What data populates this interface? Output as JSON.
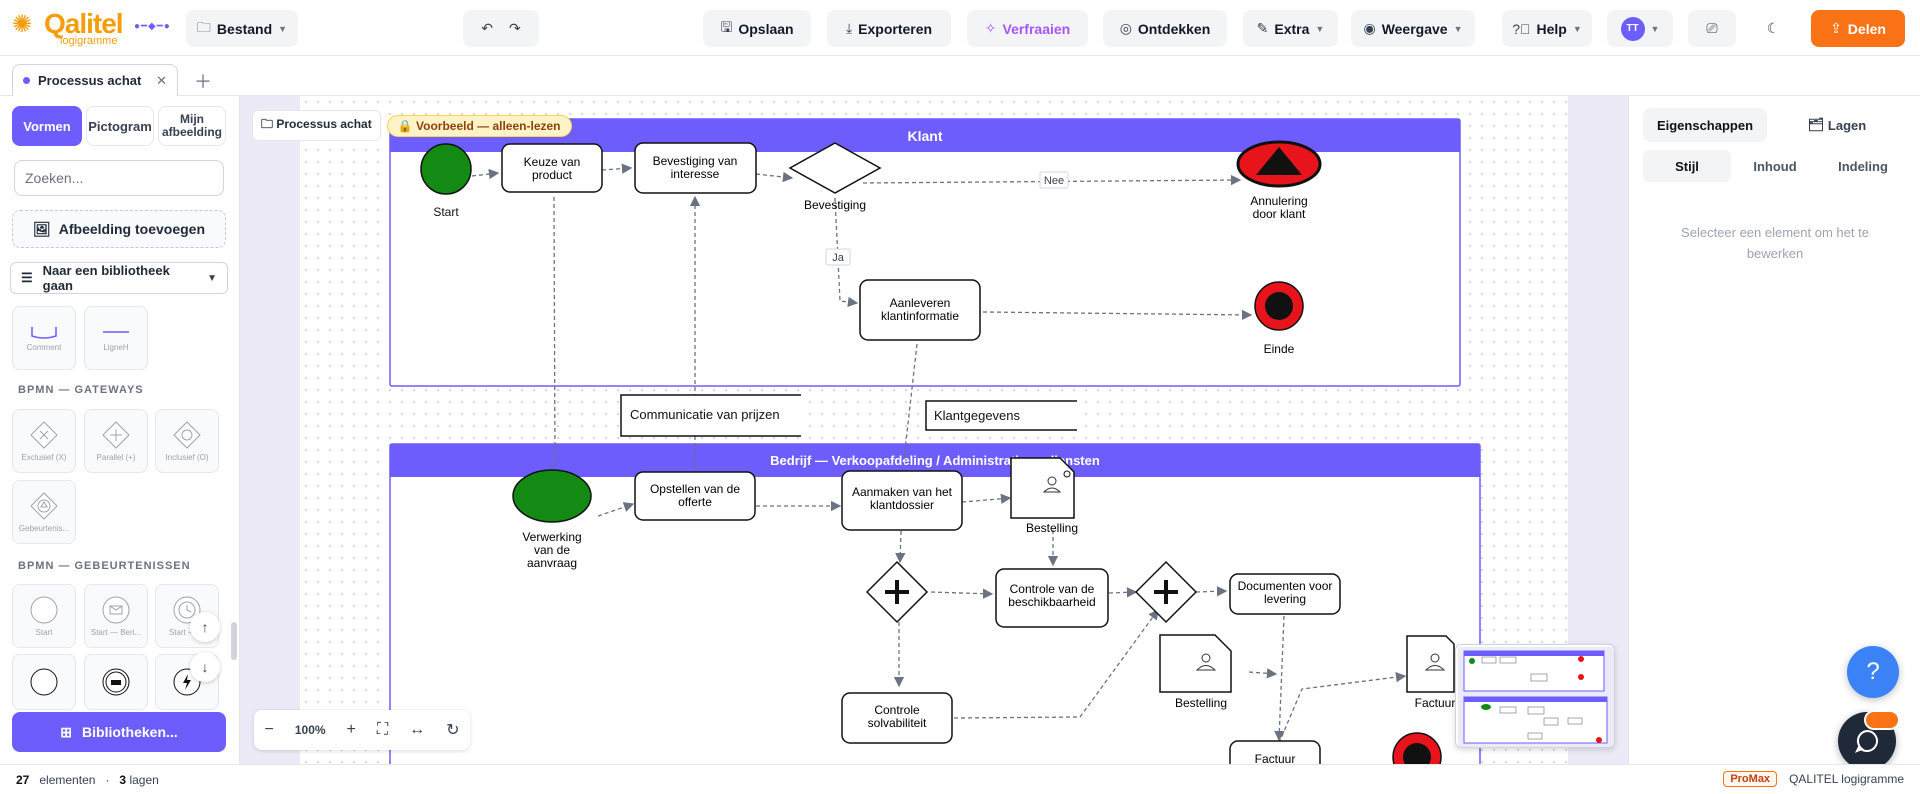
{
  "app": {
    "brand": "Qalitel",
    "brand_sub": "logigramme",
    "menu_file": "Bestand",
    "save": "Opslaan",
    "export": "Exporteren",
    "beautify": "Verfraaien",
    "discover": "Ontdekken",
    "extra": "Extra",
    "view": "Weergave",
    "help": "Help",
    "avatar_initials": "TT",
    "share": "Delen"
  },
  "tab": {
    "label": "Processus achat"
  },
  "left_panel": {
    "tabs": [
      "Vormen",
      "Pictogram",
      "Mijn afbeelding"
    ],
    "search_placeholder": "Zoeken...",
    "add_image": "Afbeelding toevoegen",
    "library_select": "Naar een bibliotheek gaan",
    "shapes_top": [
      "Comment",
      "LigneH"
    ],
    "section_gateways": "BPMN — GATEWAYS",
    "gateways": [
      "Exclusief (X)",
      "Parallel (+)",
      "Inclusief (O)",
      "Gebeurtenis..."
    ],
    "section_events": "BPMN — GEBEURTENISSEN",
    "events": [
      "Start",
      "Start — Beri...",
      "Start — ..."
    ],
    "libraries_button": "Bibliotheken..."
  },
  "canvas": {
    "breadcrumb": "Processus achat",
    "readonly_badge": "Voorbeeld — alleen-lezen",
    "zoom": "100%"
  },
  "diagram": {
    "lane_client": "Klant",
    "lane_company": "Bedrijf — Verkoopafdeling / Administratie — diensten",
    "start": "Start",
    "task_choice": [
      "Keuze van",
      "product"
    ],
    "task_confirm_interest": [
      "Bevestiging van",
      "interesse"
    ],
    "gateway_confirm": "Bevestiging",
    "flow_no": "Nee",
    "flow_yes": "Ja",
    "cancel_end": [
      "Annulering",
      "door klant"
    ],
    "task_client_info": [
      "Aanleveren",
      "klantinformatie"
    ],
    "end": "Einde",
    "msg_prices": "Communicatie van prijzen",
    "msg_client_data": "Klantgegevens",
    "start_processing": [
      "Verwerking",
      "van de",
      "aanvraag"
    ],
    "task_quote": [
      "Opstellen van de",
      "offerte"
    ],
    "task_file": [
      "Aanmaken van het",
      "klantdossier"
    ],
    "doc_order": "Bestelling",
    "task_availability": [
      "Controle van de",
      "beschikbaarheid"
    ],
    "task_delivery_docs": [
      "Documenten voor",
      "levering"
    ],
    "doc_order2": "Bestelling",
    "doc_invoice": "Factuur",
    "task_solvency": [
      "Controle",
      "solvabiliteit"
    ],
    "task_invoice": "Factuur"
  },
  "right_panel": {
    "tab_properties": "Eigenschappen",
    "tab_layers": "Lagen",
    "sub_style": "Stijl",
    "sub_content": "Inhoud",
    "sub_layout": "Indeling",
    "hint": "Selecteer een element om het te bewerken"
  },
  "status": {
    "element_count": "27",
    "elements_label": "elementen",
    "layer_count": "3",
    "layers_label": "lagen",
    "plan": "ProMax",
    "product": "QALITEL logigramme"
  },
  "colors": {
    "accent": "#6d5dfc",
    "share": "#f97316",
    "lane_header": "#6d5dfc",
    "start_event": "#138a13",
    "end_event": "#e8141b"
  }
}
